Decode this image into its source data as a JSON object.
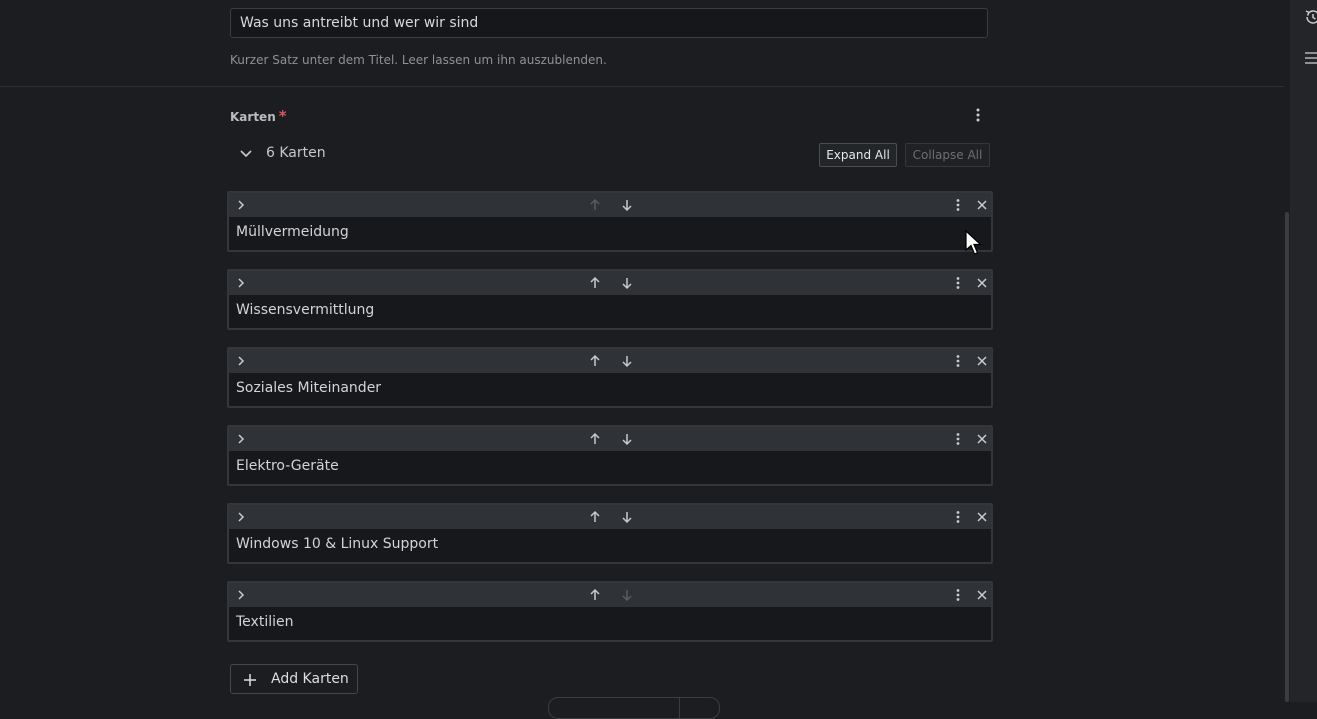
{
  "subtitle_field": {
    "value": "Was uns antreibt und wer wir sind",
    "help_text": "Kurzer Satz unter dem Titel. Leer lassen um ihn auszublenden."
  },
  "cards_field": {
    "label": "Karten",
    "required_marker": "*",
    "count_text": "6 Karten",
    "expand_all_label": "Expand All",
    "collapse_all_label": "Collapse All",
    "add_label": "Add Karten",
    "items": [
      {
        "title": "Müllvermeidung"
      },
      {
        "title": "Wissensvermittlung"
      },
      {
        "title": "Soziales Miteinander"
      },
      {
        "title": "Elektro-Geräte"
      },
      {
        "title": "Windows 10 & Linux Support"
      },
      {
        "title": "Textilien"
      }
    ]
  },
  "colors": {
    "background": "#1b1d20",
    "card_header": "#2f3236",
    "required": "#e0565a",
    "disabled_arrow": "#5a5d62",
    "icon": "#c9cbce"
  }
}
